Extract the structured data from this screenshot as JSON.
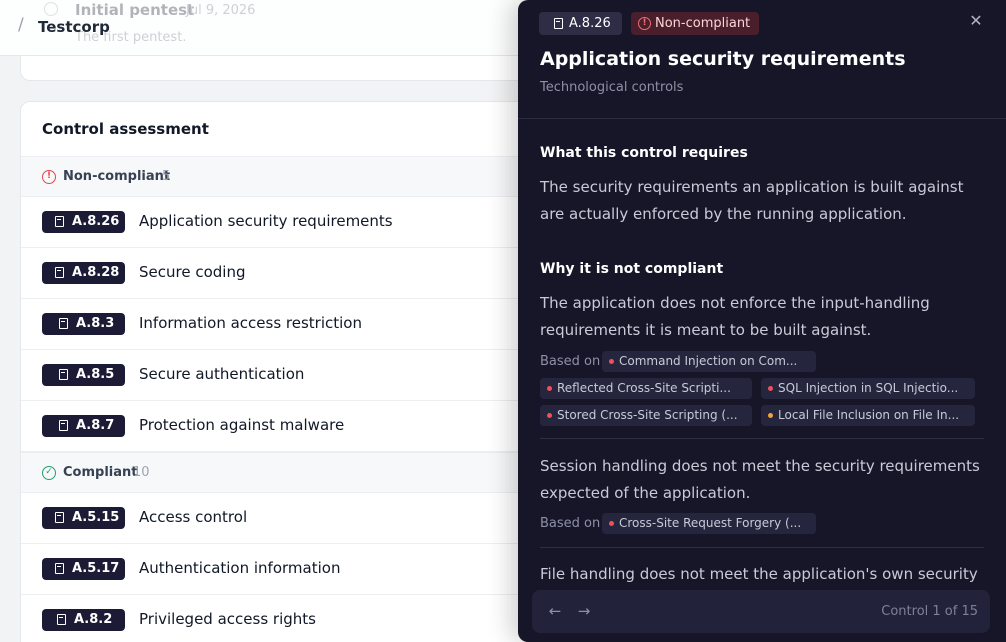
{
  "header": {
    "separator": "/",
    "org_name": "Testcorp",
    "ghost_item": {
      "title": "Initial pentest",
      "date": "Jul 9, 2026",
      "subtitle": "The first pentest."
    }
  },
  "assessment": {
    "title": "Control assessment",
    "groups": [
      {
        "label": "Non-compliant",
        "count": "5",
        "status_color": "#e0474c",
        "icon": "alert-circle-icon",
        "items": [
          {
            "code": "A.8.26",
            "title": "Application security requirements"
          },
          {
            "code": "A.8.28",
            "title": "Secure coding"
          },
          {
            "code": "A.8.3",
            "title": "Information access restriction"
          },
          {
            "code": "A.8.5",
            "title": "Secure authentication"
          },
          {
            "code": "A.8.7",
            "title": "Protection against malware"
          }
        ]
      },
      {
        "label": "Compliant",
        "count": "10",
        "status_color": "#22a06b",
        "icon": "check-circle-icon",
        "items": [
          {
            "code": "A.5.15",
            "title": "Access control"
          },
          {
            "code": "A.5.17",
            "title": "Authentication information"
          },
          {
            "code": "A.8.2",
            "title": "Privileged access rights"
          }
        ]
      }
    ]
  },
  "drawer": {
    "code": "A.8.26",
    "status": "Non-compliant",
    "status_color": "#f26d75",
    "close_icon": "close-icon",
    "title": "Application security requirements",
    "category": "Technological controls",
    "requires_heading": "What this control requires",
    "requires_text": "The security requirements an application is built against are actually enforced by the running application.",
    "why_heading": "Why it is not compliant",
    "based_on_label": "Based on",
    "findings": [
      {
        "text": "The application does not enforce the input-handling requirements it is meant to be built against.",
        "evidence": [
          {
            "label": "Command Injection on Com...",
            "severity_color": "#f0505a"
          },
          {
            "label": "Reflected Cross-Site Scripti...",
            "severity_color": "#f0505a"
          },
          {
            "label": "SQL Injection in SQL Injectio...",
            "severity_color": "#f0505a"
          },
          {
            "label": "Stored Cross-Site Scripting (...",
            "severity_color": "#f0505a"
          },
          {
            "label": "Local File Inclusion on File In...",
            "severity_color": "#f2a33a"
          }
        ]
      },
      {
        "text": "Session handling does not meet the security requirements expected of the application.",
        "evidence": [
          {
            "label": "Cross-Site Request Forgery (...",
            "severity_color": "#f0505a"
          }
        ]
      },
      {
        "text": "File handling does not meet the application's own security",
        "evidence": []
      }
    ],
    "footer": {
      "prev_icon": "arrow-left-icon",
      "next_icon": "arrow-right-icon",
      "prev_glyph": "←",
      "next_glyph": "→",
      "counter": "Control 1 of 15"
    }
  }
}
